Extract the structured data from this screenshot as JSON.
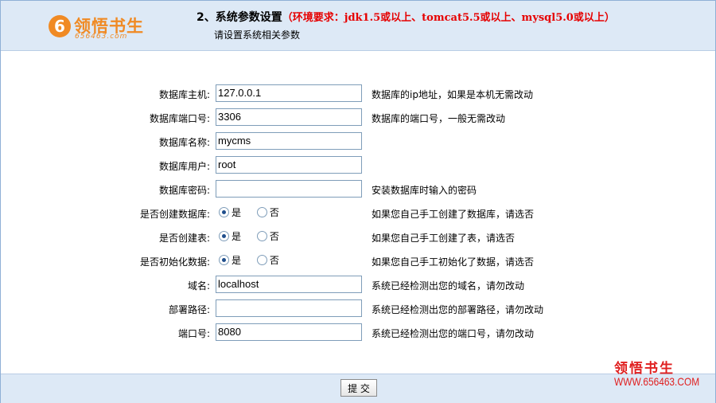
{
  "header": {
    "logo_mark": "6",
    "logo_text": "领悟书生",
    "logo_sub": "656463.com",
    "title": "2、系统参数设置",
    "requirement": "（环境要求：jdk1.5或以上、tomcat5.5或以上、mysql5.0或以上）",
    "subtitle": "请设置系统相关参数"
  },
  "form": {
    "rows": [
      {
        "label": "数据库主机:",
        "value": "127.0.0.1",
        "hint": "数据库的ip地址，如果是本机无需改动"
      },
      {
        "label": "数据库端口号:",
        "value": "3306",
        "hint": "数据库的端口号，一般无需改动"
      },
      {
        "label": "数据库名称:",
        "value": "mycms",
        "hint": ""
      },
      {
        "label": "数据库用户:",
        "value": "root",
        "hint": ""
      },
      {
        "label": "数据库密码:",
        "value": "",
        "hint": "安装数据库时输入的密码"
      },
      {
        "label": "是否创建数据库:",
        "yes": "是",
        "no": "否",
        "selected": "yes",
        "hint": "如果您自己手工创建了数据库，请选否"
      },
      {
        "label": "是否创建表:",
        "yes": "是",
        "no": "否",
        "selected": "yes",
        "hint": "如果您自己手工创建了表，请选否"
      },
      {
        "label": "是否初始化数据:",
        "yes": "是",
        "no": "否",
        "selected": "yes",
        "hint": "如果您自己手工初始化了数据，请选否"
      },
      {
        "label": "域名:",
        "value": "localhost",
        "hint": "系统已经检测出您的域名，请勿改动"
      },
      {
        "label": "部署路径:",
        "value": "",
        "hint": "系统已经检测出您的部署路径，请勿改动"
      },
      {
        "label": "端口号:",
        "value": "8080",
        "hint": "系统已经检测出您的端口号，请勿改动"
      }
    ]
  },
  "footer": {
    "submit_label": "提 交"
  },
  "watermark": {
    "text": "领悟书生",
    "url": "WWW.656463.COM"
  },
  "colors": {
    "header_bg": "#dde9f6",
    "requirement_red": "#e60000",
    "logo_orange": "#f08a24"
  }
}
